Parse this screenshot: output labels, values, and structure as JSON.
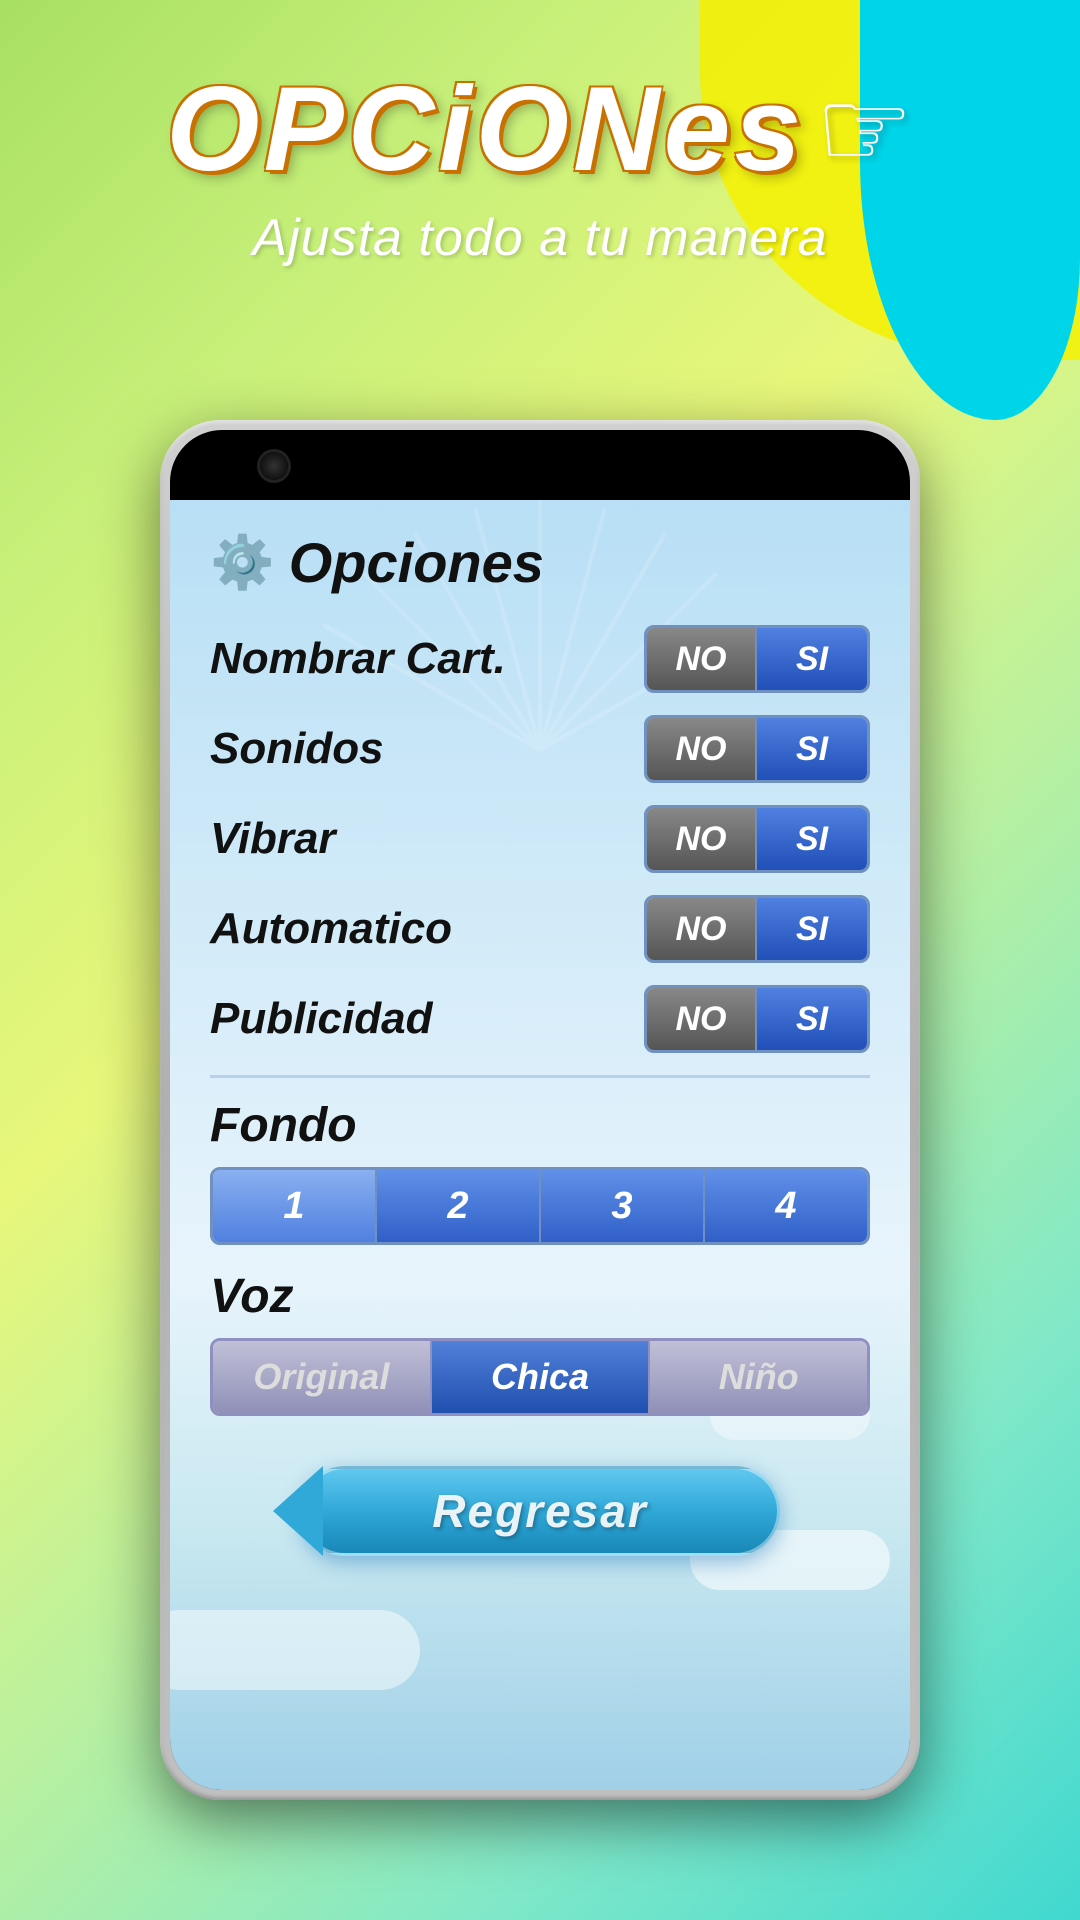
{
  "background": {
    "gradient_start": "#a8e063",
    "gradient_end": "#40d8d0"
  },
  "header": {
    "title": "OPCiONes",
    "subtitle": "Ajusta todo a tu manera",
    "hand_icon": "☞"
  },
  "screen": {
    "title": "Opciones",
    "gear_icon": "⚙",
    "options": [
      {
        "label": "Nombrar Cart.",
        "no_label": "NO",
        "si_label": "SI",
        "selected": "si"
      },
      {
        "label": "Sonidos",
        "no_label": "NO",
        "si_label": "SI",
        "selected": "si"
      },
      {
        "label": "Vibrar",
        "no_label": "NO",
        "si_label": "SI",
        "selected": "si"
      },
      {
        "label": "Automatico",
        "no_label": "NO",
        "si_label": "SI",
        "selected": "si"
      },
      {
        "label": "Publicidad",
        "no_label": "NO",
        "si_label": "SI",
        "selected": "si"
      }
    ],
    "fondo": {
      "label": "Fondo",
      "buttons": [
        "1",
        "2",
        "3",
        "4"
      ],
      "selected": 0
    },
    "voz": {
      "label": "Voz",
      "buttons": [
        "Original",
        "Chica",
        "Niño"
      ],
      "selected": 1
    },
    "regresar": {
      "label": "Regresar"
    }
  }
}
